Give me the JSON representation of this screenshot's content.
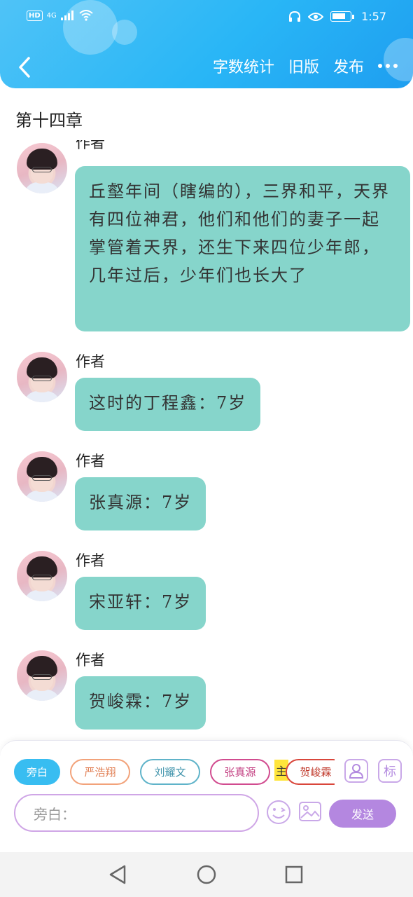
{
  "status_bar": {
    "left_badges": [
      "HD",
      "4G"
    ],
    "time": "1:57"
  },
  "header": {
    "actions": [
      {
        "label": "字数统计"
      },
      {
        "label": "旧版"
      },
      {
        "label": "发布"
      }
    ],
    "colors": {
      "accent": "#29b6f6"
    }
  },
  "chapter": {
    "title": "第十四章"
  },
  "messages": [
    {
      "sender": "作者",
      "text": "丘壑年间（瞎编的），三界和平，天界有四位神君，他们和他们的妻子一起掌管着天界，还生下来四位少年郎，几年过后，少年们也长大了"
    },
    {
      "sender": "作者",
      "text": "这时的丁程鑫：7岁"
    },
    {
      "sender": "作者",
      "text": "张真源：7岁"
    },
    {
      "sender": "作者",
      "text": "宋亚轩：7岁"
    },
    {
      "sender": "作者",
      "text": "贺峻霖：7岁"
    }
  ],
  "composer": {
    "chips": [
      {
        "label": "旁白",
        "color": "#38bdf1",
        "active": true
      },
      {
        "label": "严浩翔",
        "color": "#f2a27a",
        "active": false
      },
      {
        "label": "刘耀文",
        "color": "#5fb3c9",
        "active": false
      },
      {
        "label": "张真源",
        "color": "#d14b8f",
        "active": false
      },
      {
        "label": "贺峻霖",
        "color": "#d9463b",
        "active": false,
        "badge": "主"
      }
    ],
    "tag_icon_label": "标",
    "input_placeholder": "旁白：",
    "send_label": "发送",
    "colors": {
      "send": "#b487e0",
      "bubble": "#86d5cb"
    }
  },
  "icons": [
    "back-icon",
    "more-icon",
    "person-icon",
    "emoji-icon",
    "image-icon",
    "nav-back-icon",
    "nav-home-icon",
    "nav-recents-icon"
  ]
}
